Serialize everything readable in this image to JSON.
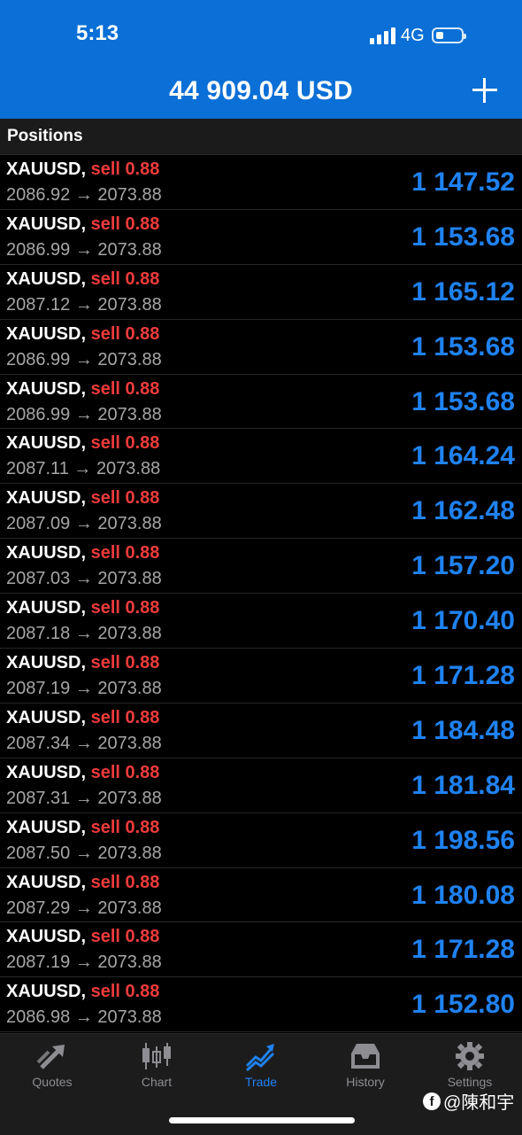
{
  "status_bar": {
    "time": "5:13",
    "network": "4G"
  },
  "header": {
    "balance": "44 909.04 USD"
  },
  "section": {
    "title": "Positions"
  },
  "positions": [
    {
      "symbol": "XAUUSD",
      "comma": ",",
      "side": "sell 0.88",
      "open": "2086.92",
      "arrow": "→",
      "current": "2073.88",
      "profit": "1 147.52"
    },
    {
      "symbol": "XAUUSD",
      "comma": ",",
      "side": "sell 0.88",
      "open": "2086.99",
      "arrow": "→",
      "current": "2073.88",
      "profit": "1 153.68"
    },
    {
      "symbol": "XAUUSD",
      "comma": ",",
      "side": "sell 0.88",
      "open": "2087.12",
      "arrow": "→",
      "current": "2073.88",
      "profit": "1 165.12"
    },
    {
      "symbol": "XAUUSD",
      "comma": ",",
      "side": "sell 0.88",
      "open": "2086.99",
      "arrow": "→",
      "current": "2073.88",
      "profit": "1 153.68"
    },
    {
      "symbol": "XAUUSD",
      "comma": ",",
      "side": "sell 0.88",
      "open": "2086.99",
      "arrow": "→",
      "current": "2073.88",
      "profit": "1 153.68"
    },
    {
      "symbol": "XAUUSD",
      "comma": ",",
      "side": "sell 0.88",
      "open": "2087.11",
      "arrow": "→",
      "current": "2073.88",
      "profit": "1 164.24"
    },
    {
      "symbol": "XAUUSD",
      "comma": ",",
      "side": "sell 0.88",
      "open": "2087.09",
      "arrow": "→",
      "current": "2073.88",
      "profit": "1 162.48"
    },
    {
      "symbol": "XAUUSD",
      "comma": ",",
      "side": "sell 0.88",
      "open": "2087.03",
      "arrow": "→",
      "current": "2073.88",
      "profit": "1 157.20"
    },
    {
      "symbol": "XAUUSD",
      "comma": ",",
      "side": "sell 0.88",
      "open": "2087.18",
      "arrow": "→",
      "current": "2073.88",
      "profit": "1 170.40"
    },
    {
      "symbol": "XAUUSD",
      "comma": ",",
      "side": "sell 0.88",
      "open": "2087.19",
      "arrow": "→",
      "current": "2073.88",
      "profit": "1 171.28"
    },
    {
      "symbol": "XAUUSD",
      "comma": ",",
      "side": "sell 0.88",
      "open": "2087.34",
      "arrow": "→",
      "current": "2073.88",
      "profit": "1 184.48"
    },
    {
      "symbol": "XAUUSD",
      "comma": ",",
      "side": "sell 0.88",
      "open": "2087.31",
      "arrow": "→",
      "current": "2073.88",
      "profit": "1 181.84"
    },
    {
      "symbol": "XAUUSD",
      "comma": ",",
      "side": "sell 0.88",
      "open": "2087.50",
      "arrow": "→",
      "current": "2073.88",
      "profit": "1 198.56"
    },
    {
      "symbol": "XAUUSD",
      "comma": ",",
      "side": "sell 0.88",
      "open": "2087.29",
      "arrow": "→",
      "current": "2073.88",
      "profit": "1 180.08"
    },
    {
      "symbol": "XAUUSD",
      "comma": ",",
      "side": "sell 0.88",
      "open": "2087.19",
      "arrow": "→",
      "current": "2073.88",
      "profit": "1 171.28"
    },
    {
      "symbol": "XAUUSD",
      "comma": ",",
      "side": "sell 0.88",
      "open": "2086.98",
      "arrow": "→",
      "current": "2073.88",
      "profit": "1 152.80"
    }
  ],
  "tabbar": {
    "tabs": [
      {
        "label": "Quotes",
        "icon": "quotes-arrows-icon"
      },
      {
        "label": "Chart",
        "icon": "candlestick-chart-icon"
      },
      {
        "label": "Trade",
        "icon": "trade-trend-icon",
        "active": true
      },
      {
        "label": "History",
        "icon": "history-inbox-icon"
      },
      {
        "label": "Settings",
        "icon": "gear-icon"
      }
    ]
  },
  "watermark": {
    "text": "@陳和宇",
    "logo": "f"
  },
  "colors": {
    "header_bg": "#0a6fd6",
    "sell": "#ef3b3b",
    "profit": "#1f82f2",
    "tab_active": "#1f82f2",
    "tab_inactive": "#8d8d92"
  }
}
